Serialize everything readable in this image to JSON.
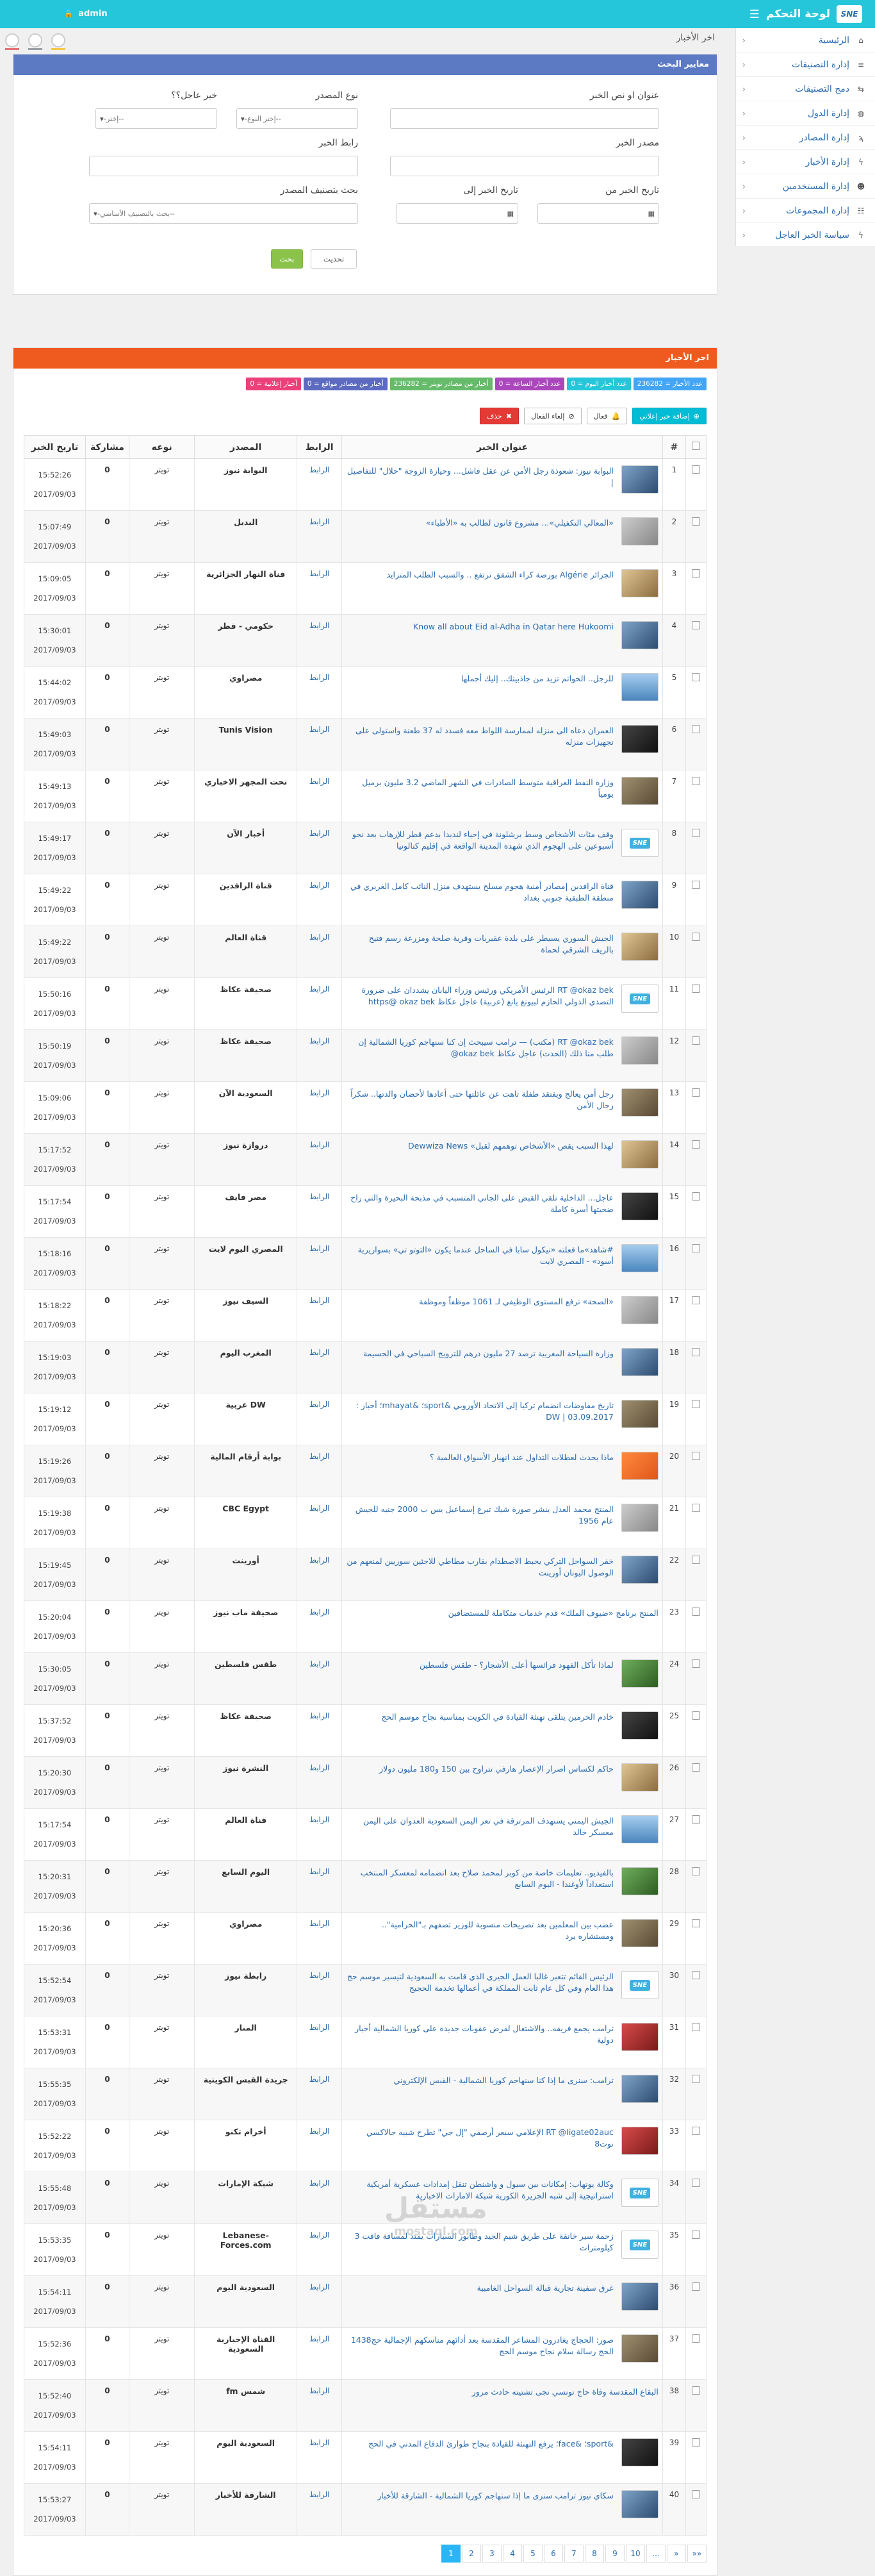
{
  "topbar": {
    "brand_title": "لوحة التحكم",
    "logo_text": "SNE",
    "admin_label": "admin"
  },
  "sidebar": {
    "items": [
      {
        "label": "الرئيسية",
        "icon": "home-icon",
        "glyph": "⌂"
      },
      {
        "label": "إدارة التصنيفات",
        "icon": "list-icon",
        "glyph": "≡"
      },
      {
        "label": "دمج التصنيفات",
        "icon": "merge-icon",
        "glyph": "⇆"
      },
      {
        "label": "إدارة الدول",
        "icon": "globe-icon",
        "glyph": "◍"
      },
      {
        "label": "إدارة المصادر",
        "icon": "rss-icon",
        "glyph": "ϡ"
      },
      {
        "label": "إدارة الأخبار",
        "icon": "bolt-icon",
        "glyph": "ϟ"
      },
      {
        "label": "إدارة المستخدمين",
        "icon": "user-icon",
        "glyph": "☻"
      },
      {
        "label": "إدارة المجموعات",
        "icon": "group-icon",
        "glyph": "☷"
      },
      {
        "label": "سياسة الخبر العاجل",
        "icon": "bolt-icon",
        "glyph": "ϟ"
      }
    ]
  },
  "page": {
    "title": "اخر الأخبار"
  },
  "search": {
    "panel_title": "معايير البحث",
    "labels": {
      "title": "عنوان او نص الخبر",
      "source_type": "نوع المصدر",
      "urgent": "خبر عاجل؟؟",
      "source": "مصدر الخبر",
      "link": "رابط الخبر",
      "date_from": "تاريخ الخبر من",
      "date_to": "تاريخ الخبر إلى",
      "source_class": "بحث بتصنيف المصدر"
    },
    "values": {
      "source_type": "--إختر النوع--",
      "urgent": "--إختر--",
      "source_class": "--بحث بالتصنيف الأساسي--"
    },
    "buttons": {
      "search": "بحث",
      "update": "تحديث"
    }
  },
  "news": {
    "panel_title": "اخر الأخبار",
    "badges": [
      {
        "text": "عدد الأخبار = 236282",
        "color": "#42a5f5"
      },
      {
        "text": "عدد أخبار اليوم = 0",
        "color": "#26c6da"
      },
      {
        "text": "عدد أخبار الساعة = 0",
        "color": "#ab47bc"
      },
      {
        "text": "أخبار من مصادر تويتر = 236282",
        "color": "#66bb6a"
      },
      {
        "text": "أخبار من مصادر مواقع = 0",
        "color": "#5c6bc0"
      },
      {
        "text": "أخبار إعلانية = 0",
        "color": "#ec407a"
      }
    ],
    "actions": {
      "exclusive": "إضافة خبر إعلاني",
      "activate": "فعال",
      "deactivate": "إلغاء الفعال",
      "delete": "حذف"
    },
    "columns": {
      "num": "#",
      "title": "عنوان الخبر",
      "link": "الرابط",
      "source": "المصدر",
      "type": "نوعه",
      "share": "مشاركة",
      "date": "تاريخ الخبر"
    },
    "rows": [
      {
        "n": "1",
        "title": "البوابة نيوز: شعوذة رجل الأمن عن عقل فاشل... وحيازة الزوجة \"حلال\" للتفاصيل |",
        "source": "البوابة نيوز",
        "time": "15:52:26",
        "date": "2017/09/03",
        "thumb": "t-blue"
      },
      {
        "n": "2",
        "title": "«المعالي التكفيلي»... مشروع قانون لطالب به «الأطباء»",
        "source": "البديل",
        "time": "15:07:49",
        "date": "2017/09/03",
        "thumb": "t-gray"
      },
      {
        "n": "3",
        "title": "الجزائر Algérie بورصة كراء الشقق ترتفع .. والسبب الطلب المتزايد",
        "source": "قناة النهار الجزائرية",
        "time": "15:09:05",
        "date": "2017/09/03",
        "thumb": "t-sand"
      },
      {
        "n": "4",
        "title": "Know all about Eid al-Adha in Qatar here Hukoomi",
        "source": "حكومي - قطر",
        "time": "15:30:01",
        "date": "2017/09/03",
        "thumb": "t-blue"
      },
      {
        "n": "5",
        "title": "للرجل.. الخواتم تزيد من جاذبيتك.. إليك أجملها",
        "source": "مصراوي",
        "time": "15:44:02",
        "date": "2017/09/03",
        "thumb": "t-sky"
      },
      {
        "n": "6",
        "title": "العمران دعاه الى منزله لممارسة اللواط معه فسدد له 37 طعنة واستولى على تجهيزات منزله",
        "source": "Tunis Vision",
        "time": "15:49:03",
        "date": "2017/09/03",
        "thumb": "t-dark"
      },
      {
        "n": "7",
        "title": "وزارة النفط العراقية متوسط الصادرات في الشهر الماضي 3.2 مليون برميل يومياً",
        "source": "تحت المجهر الاخباري",
        "time": "15:49:13",
        "date": "2017/09/03",
        "thumb": "t-crowd"
      },
      {
        "n": "8",
        "title": "وقف مئات الأشخاص وسط برشلونة في إحياء لنديدا بدعم قطر للإرهاب بعد نحو أسبوعين على الهجوم الذي شهده المدينة الواقعة في إقليم كتالونيا",
        "source": "أخبار الآن",
        "time": "15:49:17",
        "date": "2017/09/03",
        "thumb": "logo"
      },
      {
        "n": "9",
        "title": "قناة الرافدين |مصادر أمنية هجوم مسلح يستهدف منزل النائب كامل الغريري في منطقة الطبقية جنوبي بغداد",
        "source": "قناة الرافدين",
        "time": "15:49:22",
        "date": "2017/09/03",
        "thumb": "t-blue"
      },
      {
        "n": "10",
        "title": "الجيش السوري يسيطر على بلدة عقيربات وقرية صلحة ومزرعة رسم فتيح بالريف الشرقي لحماة",
        "source": "قناة العالم",
        "time": "15:49:22",
        "date": "2017/09/03",
        "thumb": "t-sand"
      },
      {
        "n": "11",
        "title": "RT @okaz bek الرئيس الأمريكي ورئيس وزراء اليابان يشددان على ضرورة التصدي الدولي الحازم لبيونغ يانغ (عربية) عاجل عكاظ https@ okaz bek",
        "source": "صحيفة عكاظ",
        "time": "15:50:16",
        "date": "2017/09/03",
        "thumb": "logo"
      },
      {
        "n": "12",
        "title": "RT @okaz bek (مكتب) — ترامب سيبحث إن كنا سنهاجم كوريا الشمالية إن طلب منا ذلك (الحدث) عاجل عكاظ okaz bek@",
        "source": "صحيفة عكاظ",
        "time": "15:50:19",
        "date": "2017/09/03",
        "thumb": "t-gray"
      },
      {
        "n": "13",
        "title": "رجل أمن يعالج ويفتقد طفلة تاهت عن عائلتها حتى أعادها لأحضان والدتها.. شكراً رجال الأمن",
        "source": "السعودية الآن",
        "time": "15:09:06",
        "date": "2017/09/03",
        "thumb": "t-crowd"
      },
      {
        "n": "14",
        "title": "لهذا السبب يقص «الأشخاص توهمهم لقبل» Dewwiza News",
        "source": "دروازة نيوز",
        "time": "15:17:52",
        "date": "2017/09/03",
        "thumb": "t-sand"
      },
      {
        "n": "15",
        "title": "عاجل... الداخلية تلقي القبض على الجاني المتسبب في مذبحة البحيرة والتي راح ضحيتها أسرة كاملة",
        "source": "مصر فايف",
        "time": "15:17:54",
        "date": "2017/09/03",
        "thumb": "t-dark"
      },
      {
        "n": "16",
        "title": "#شاهد»ما فعلته «نيكول سابا في الساحل عندما يكون «التوتو تي» بسواريرية أسود» - المصري لايت",
        "source": "المصري اليوم لايت",
        "time": "15:18:16",
        "date": "2017/09/03",
        "thumb": "t-sky"
      },
      {
        "n": "17",
        "title": "«الصحة» ترفع المستوى الوظيفي لـ 1061 موظفاً وموظفة",
        "source": "السيف نيوز",
        "time": "15:18:22",
        "date": "2017/09/03",
        "thumb": "t-gray"
      },
      {
        "n": "18",
        "title": "وزارة السياحة المغربية ترصد 27 مليون درهم للترويج السياحي في الحسيمة",
        "source": "المغرب اليوم",
        "time": "15:19:03",
        "date": "2017/09/03",
        "thumb": "t-blue"
      },
      {
        "n": "19",
        "title": "تاريخ مفاوضات انضمام تركيا إلى الاتحاد الأوروبي &sport؛ &mhayat؛ أخبار : DW | 03.09.2017",
        "source": "DW عربية",
        "time": "15:19:12",
        "date": "2017/09/03",
        "thumb": "t-crowd"
      },
      {
        "n": "20",
        "title": "ماذا يحدث لعطلات التداول عند انهيار الأسواق العالمية ؟",
        "source": "بوابة أرقام المالية",
        "time": "15:19:26",
        "date": "2017/09/03",
        "thumb": "t-orange"
      },
      {
        "n": "21",
        "title": "المنتج محمد العدل ينشر صورة شيك تبرع إسماعيل يس ب 2000 جنيه للجيش عام 1956",
        "source": "CBC Egypt",
        "time": "15:19:38",
        "date": "2017/09/03",
        "thumb": "t-gray"
      },
      {
        "n": "22",
        "title": "خفر السواحل التركي يحبط الاصطدام بقارب مطاطي للاجئين سوريين لمنعهم من الوصول اليونان أورينت",
        "source": "أورينت",
        "time": "15:19:45",
        "date": "2017/09/03",
        "thumb": "t-blue"
      },
      {
        "n": "23",
        "title": "المنتج برنامج «ضيوف الملك» قدم خدمات متكاملة للمستضافين",
        "source": "صحيفة ماب نيوز",
        "time": "15:20:04",
        "date": "2017/09/03",
        "thumb": "none"
      },
      {
        "n": "24",
        "title": "لماذا تأكل الفهود فرائسها أعلى الأشجار؟ - طقس فلسطين",
        "source": "طقس فلسطين",
        "time": "15:30:05",
        "date": "2017/09/03",
        "thumb": "t-green"
      },
      {
        "n": "25",
        "title": "خادم الحرمين يتلقى تهنئة القيادة في الكويت بمناسبة نجاح موسم الحج",
        "source": "صحيفة عكاظ",
        "time": "15:37:52",
        "date": "2017/09/03",
        "thumb": "t-dark"
      },
      {
        "n": "26",
        "title": "حاكم لكساس اضرار الإعصار هارفي تتراوح بين 150 و180 مليون دولار",
        "source": "النشرة نيوز",
        "time": "15:20:30",
        "date": "2017/09/03",
        "thumb": "t-sand"
      },
      {
        "n": "27",
        "title": "الجيش اليمني يستهدف المرتزقة في تعز اليمن السعودية العدوان على اليمن معسكر خالد",
        "source": "قناة العالم",
        "time": "15:17:54",
        "date": "2017/09/03",
        "thumb": "t-sky"
      },
      {
        "n": "28",
        "title": "بالفيديو.. تعليمات خاصة من كوبر لمحمد صلاح بعد انضمامه لمعسكر المنتخب استعداداً لأوغندا - اليوم السابع",
        "source": "اليوم السابع",
        "time": "15:20:31",
        "date": "2017/09/03",
        "thumb": "t-green"
      },
      {
        "n": "29",
        "title": "عضب بين المعلمين بعد تصريحات منسوبة للوزير تصفهم بـ\"الحرامية\".. ومستشاره يرد",
        "source": "مصراوي",
        "time": "15:20:36",
        "date": "2017/09/03",
        "thumb": "t-crowd"
      },
      {
        "n": "30",
        "title": "الرئيس القائم تتعبر غالبا العمل الخيري الذي قامت به السعودية لتيسير موسم حج هذا العام وفي كل عام ثابت المملكة في أعمالها تخدمة الحجيج",
        "source": "رابطة نيوز",
        "time": "15:52:54",
        "date": "2017/09/03",
        "thumb": "logo"
      },
      {
        "n": "31",
        "title": "ترامب يجمع فريقه.. والاشتعال لفرض عقوبات جديدة على كوريا الشمالية أخبار دولية",
        "source": "المنار",
        "time": "15:53:31",
        "date": "2017/09/03",
        "thumb": "t-red"
      },
      {
        "n": "32",
        "title": "ترامب: سنرى ما إذا كنا سنهاجم كوريا الشمالية - القبس الإلكتروني",
        "source": "جريدة القبس الكويتية",
        "time": "15:55:35",
        "date": "2017/09/03",
        "thumb": "t-blue"
      },
      {
        "n": "33",
        "title": "RT @Iigate02auc الإعلامي سيعر أرصفي \"إل جي\" تطرح شبيه جالاكسي نوت8",
        "source": "أخرام تكنو",
        "time": "15:52:22",
        "date": "2017/09/03",
        "thumb": "t-red"
      },
      {
        "n": "34",
        "title": "وكالة يونهاب: إمكانات بين سيول و واشنطن تنقل إمدادات عسكرية أمريكية استراتيجية إلى شبه الجزيرة الكورية شبكة الامارات الاخبارية",
        "source": "شبكة الإمارات",
        "time": "15:55:48",
        "date": "2017/09/03",
        "thumb": "logo"
      },
      {
        "n": "35",
        "title": "زحمة سير خانقة على طريق شيم الجيد وطابور السيارات يمتد لمسافة فاقت 3 كيلومترات",
        "source": "Lebanese-Forces.com",
        "time": "15:53:35",
        "date": "2017/09/03",
        "thumb": "logo"
      },
      {
        "n": "36",
        "title": "غرق سفينة تجارية قبالة السواحل الغامبية",
        "source": "السعودية اليوم",
        "time": "15:54:11",
        "date": "2017/09/03",
        "thumb": "t-blue"
      },
      {
        "n": "37",
        "title": "صور: الحجاج يغادرون المشاعر المقدسة بعد أدائهم مناسكهم الإجمالية حج1438 الحج رسالة سلام نجاح موسم الحج",
        "source": "القناة الإخبارية السعودية",
        "time": "15:52:36",
        "date": "2017/09/03",
        "thumb": "t-crowd"
      },
      {
        "n": "38",
        "title": "البقاع المقدسة وفاة حاج تونسي نجى تشتيته حادث مرور",
        "source": "شمس fm",
        "time": "15:52:40",
        "date": "2017/09/03",
        "thumb": "none"
      },
      {
        "n": "39",
        "title": "&sport؛ &face؛ يرفع التهنئة للقيادة بنجاح طوارئ الدفاع المدني في الحج",
        "source": "السعودية اليوم",
        "time": "15:54:11",
        "date": "2017/09/03",
        "thumb": "t-dark"
      },
      {
        "n": "40",
        "title": "سكاي نيوز ترامب سنرى ما إذا سنهاجم كوريا الشمالية - الشارقة للأخبار",
        "source": "الشارقة للأخبار",
        "time": "15:53:27",
        "date": "2017/09/03",
        "thumb": "t-blue"
      }
    ],
    "row_link_label": "الرابط",
    "row_type_label": "تويتر",
    "row_share_value": "0"
  },
  "pagination": {
    "pages": [
      "1",
      "2",
      "3",
      "4",
      "5",
      "6",
      "7",
      "8",
      "9",
      "10",
      "...",
      "»",
      "»»"
    ],
    "active": "1"
  },
  "watermark": {
    "main": "مستقل",
    "sub": "mostaql.com"
  }
}
